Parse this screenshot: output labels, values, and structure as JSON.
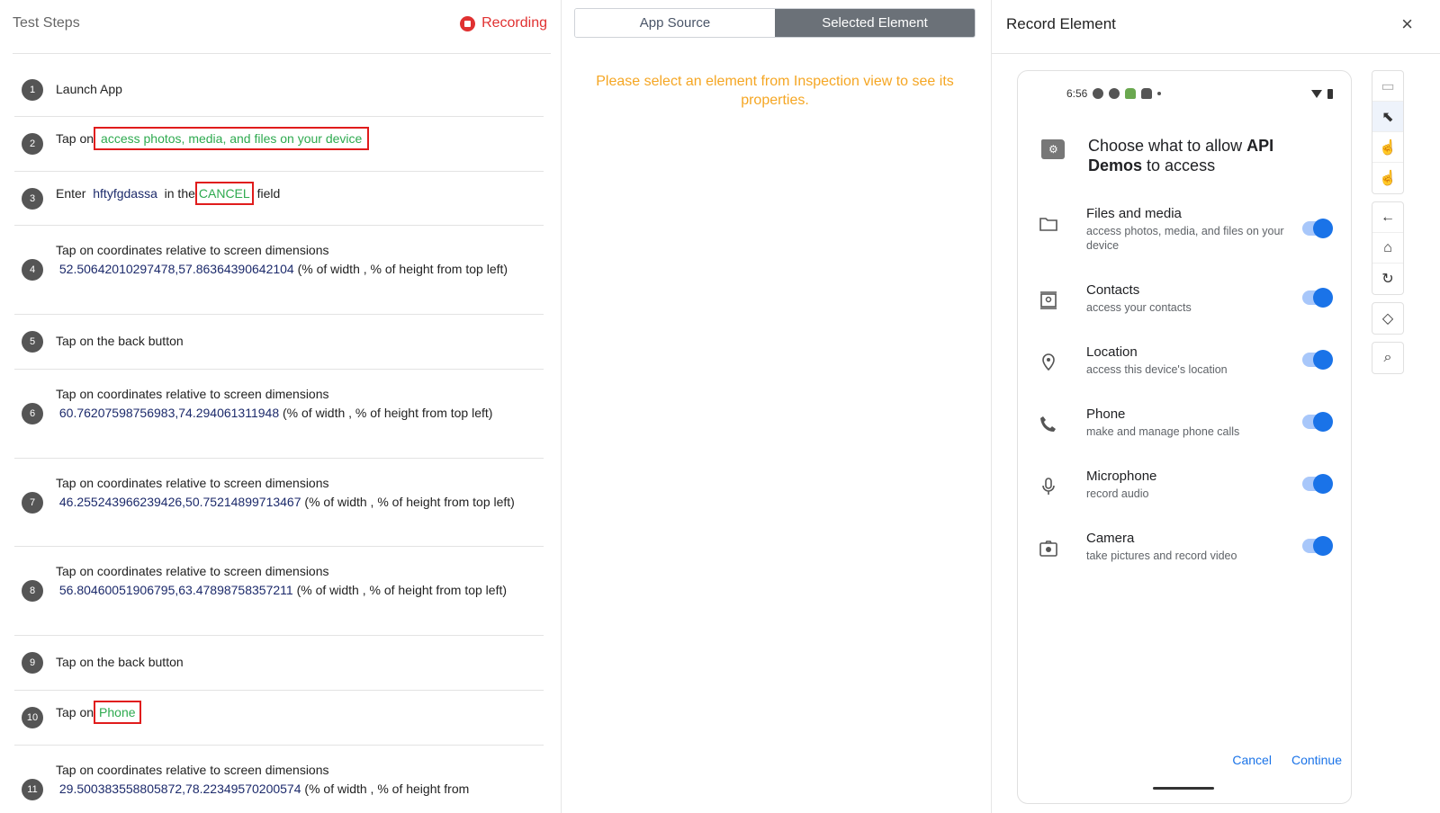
{
  "left": {
    "title": "Test Steps",
    "recording_label": "Recording",
    "steps": [
      {
        "num": "1",
        "text": "Launch App"
      },
      {
        "num": "2",
        "prefix": "Tap on",
        "target": "access photos, media, and files on your device"
      },
      {
        "num": "3",
        "prefix": "Enter",
        "value": "hftyfgdassa",
        "middle": "in the",
        "target": "CANCEL",
        "suffix": "field"
      },
      {
        "num": "4",
        "line1": "Tap on coordinates relative to screen dimensions",
        "coords": "52.50642010297478,57.86364390642104",
        "rest": "(% of width , % of height from top left)"
      },
      {
        "num": "5",
        "text": "Tap on the back button"
      },
      {
        "num": "6",
        "line1": "Tap on coordinates relative to screen dimensions",
        "coords": "60.76207598756983,74.294061311948",
        "rest": "(% of width , % of height from top left)"
      },
      {
        "num": "7",
        "line1": "Tap on coordinates relative to screen dimensions",
        "coords": "46.255243966239426,50.75214899713467",
        "rest": "(% of width , % of height from top left)"
      },
      {
        "num": "8",
        "line1": "Tap on coordinates relative to screen dimensions",
        "coords": "56.80460051906795,63.47898758357211",
        "rest": "(% of width , % of height from top left)"
      },
      {
        "num": "9",
        "text": "Tap on the back button"
      },
      {
        "num": "10",
        "prefix": "Tap on",
        "target": "Phone"
      },
      {
        "num": "11",
        "line1": "Tap on coordinates relative to screen dimensions",
        "coords": "29.500383558805872,78.22349570200574",
        "rest": "(% of width , % of height from"
      }
    ]
  },
  "middle": {
    "tabs": [
      "App Source",
      "Selected Element"
    ],
    "message": "Please select an element from Inspection view to see its properties."
  },
  "right": {
    "title": "Record Element",
    "close_icon": "×",
    "phone": {
      "time": "6:56",
      "dialog_title_pre": "Choose what to allow ",
      "dialog_title_app": "API Demos",
      "dialog_title_post": " to access",
      "permissions": [
        {
          "name": "Files and media",
          "desc": "access photos, media, and files on your device",
          "icon": "folder-icon"
        },
        {
          "name": "Contacts",
          "desc": "access your contacts",
          "icon": "contacts-icon"
        },
        {
          "name": "Location",
          "desc": "access this device's location",
          "icon": "location-icon"
        },
        {
          "name": "Phone",
          "desc": "make and manage phone calls",
          "icon": "phone-icon"
        },
        {
          "name": "Microphone",
          "desc": "record audio",
          "icon": "microphone-icon"
        },
        {
          "name": "Camera",
          "desc": "take pictures and record video",
          "icon": "camera-icon"
        }
      ],
      "cancel_label": "Cancel",
      "continue_label": "Continue"
    },
    "tools": {
      "device_icon": "▭",
      "select_icon": "⬉",
      "swipe_icon": "☝",
      "tap_icon": "☝",
      "back_icon": "←",
      "home_icon": "⌂",
      "refresh_icon": "↻",
      "rotate_icon": "◇",
      "search_icon": "⌕"
    }
  },
  "colors": {
    "recording": "#e03131",
    "accent": "#1a73e8",
    "element_green": "#2eaa4f",
    "message_orange": "#f5a623"
  }
}
